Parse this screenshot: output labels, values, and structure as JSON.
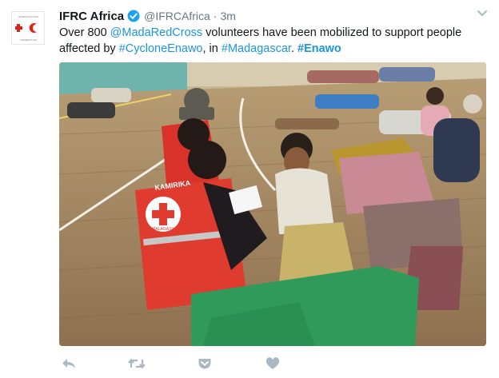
{
  "account": {
    "name": "IFRC Africa",
    "handle": "@IFRCAfrica",
    "separator": "·",
    "time": "3m",
    "avatar_logo": "INTERNATIONAL + C FEDERATION",
    "avatar_line_top": "INTERNATIONAL",
    "avatar_line_bottom": "FEDERATION"
  },
  "tweet": {
    "part1": "Over 800 ",
    "mention": "@MadaRedCross",
    "part2": " volunteers have been mobilized to support people affected by ",
    "hashtag1": "#CycloneEnawo",
    "part3": ", in ",
    "hashtag2": "#Madagascar",
    "part4": ". ",
    "hashtag3": "#Enawo"
  },
  "media": {
    "vest_text": "KAMIRIKA",
    "badge_text": "MALAGASY"
  },
  "icons": {
    "verified": "verified-badge-icon",
    "caret": "chevron-down-icon",
    "reply": "reply-icon",
    "retweet": "retweet-icon",
    "pocket": "pocket-icon",
    "like": "heart-icon"
  },
  "colors": {
    "link": "#1b95e0",
    "action_icon": "#aab8c2",
    "red_cross": "#e2231a",
    "verified": "#1da1f2"
  }
}
